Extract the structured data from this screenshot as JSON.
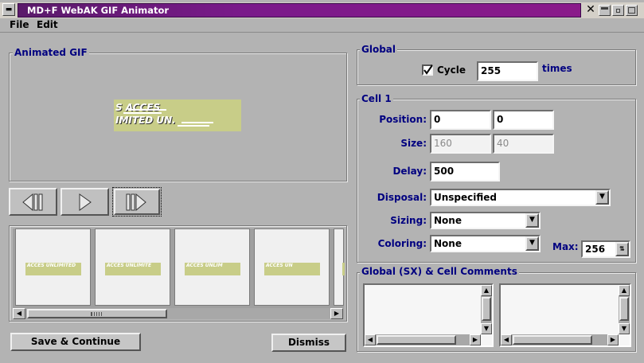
{
  "window": {
    "title": "MD+F WebAK GIF Animator"
  },
  "menu": {
    "file": "File",
    "edit": "Edit"
  },
  "left": {
    "group_title": "Animated GIF",
    "preview_text_top": "S   ACCES",
    "preview_text_bottom": "IMITED   UN.",
    "thumbs": [
      "ACCES UNLIMITED",
      "ACCES UNLIMITE",
      "ACCES UNLIM",
      "ACCES UN",
      "..."
    ],
    "save_label": "Save & Continue",
    "dismiss_label": "Dismiss"
  },
  "global": {
    "group_title": "Global",
    "cycle_label": "Cycle",
    "cycle_checked": true,
    "cycle_value": "255",
    "times_label": "times"
  },
  "cell": {
    "group_title": "Cell 1",
    "position_label": "Position:",
    "pos_x": "0",
    "pos_y": "0",
    "size_label": "Size:",
    "size_w": "160",
    "size_h": "40",
    "delay_label": "Delay:",
    "delay_value": "500",
    "disposal_label": "Disposal:",
    "disposal_value": "Unspecified",
    "sizing_label": "Sizing:",
    "sizing_value": "None",
    "coloring_label": "Coloring:",
    "coloring_value": "None",
    "max_label": "Max:",
    "max_value": "256"
  },
  "comments": {
    "group_title": "Global (SX) & Cell Comments"
  },
  "colors": {
    "title_bar": "#7a1a8a",
    "label_blue": "#000080",
    "preview_bg": "#c8cd88"
  },
  "icons": [
    "window-menu-icon",
    "close-icon",
    "minimize-icon",
    "maximize-icon",
    "check-icon",
    "chevron-down-icon",
    "prev-frame-icon",
    "play-icon",
    "next-frame-icon",
    "arrow-left-icon",
    "arrow-right-icon",
    "arrow-up-icon",
    "arrow-down-icon"
  ]
}
